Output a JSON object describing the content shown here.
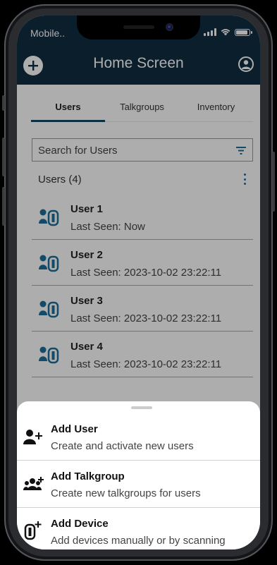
{
  "status_bar": {
    "carrier": "Mobile.."
  },
  "header": {
    "title": "Home Screen"
  },
  "tabs": [
    {
      "label": "Users",
      "active": true
    },
    {
      "label": "Talkgroups",
      "active": false
    },
    {
      "label": "Inventory",
      "active": false
    }
  ],
  "search": {
    "placeholder": "Search for Users"
  },
  "users_section": {
    "header": "Users (4)"
  },
  "users": [
    {
      "name": "User 1",
      "last_seen": "Last Seen: Now"
    },
    {
      "name": "User 2",
      "last_seen": "Last Seen: 2023-10-02 23:22:11"
    },
    {
      "name": "User 3",
      "last_seen": "Last Seen: 2023-10-02 23:22:11"
    },
    {
      "name": "User 4",
      "last_seen": "Last Seen: 2023-10-02 23:22:11"
    }
  ],
  "sheet": {
    "items": [
      {
        "icon": "add-user-icon",
        "title": "Add User",
        "subtitle": "Create and activate new users"
      },
      {
        "icon": "add-group-icon",
        "title": "Add Talkgroup",
        "subtitle": "Create new talkgroups for users"
      },
      {
        "icon": "add-device-icon",
        "title": "Add Device",
        "subtitle": "Add devices manually or by scanning"
      }
    ]
  },
  "colors": {
    "header_bg": "#0f2d40",
    "accent": "#11455f",
    "icon_blue": "#1d6d99",
    "overlay": "rgba(0,0,0,0.32)"
  }
}
